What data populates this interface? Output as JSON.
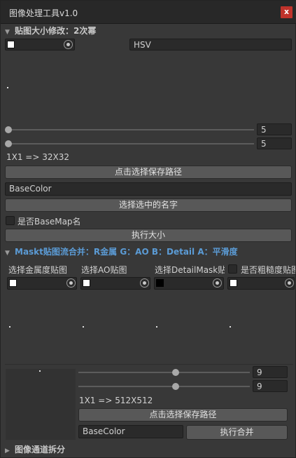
{
  "window": {
    "title": "图像处理工具v1.0",
    "close_label": "x"
  },
  "resize_section": {
    "header": "贴图大小修改：2次幂",
    "color_value": "#ffffff",
    "mode_field": "HSV",
    "slider1_value": "5",
    "slider2_value": "5",
    "size_info": "1X1 => 32X32",
    "choose_path_button": "点击选择保存路径",
    "name_field": "BaseColor",
    "select_name_button": "选择选中的名字",
    "basemap_checkbox_label": "是否BaseMap名",
    "execute_resize_button": "执行大小"
  },
  "mask_section": {
    "header_prefix": "Maskt贴图流合并：",
    "header_channels": "R金属 G：AO B：Detail A：平滑度",
    "channel_labels": [
      "选择金属度贴图",
      "选择AO贴图",
      "选择DetailMask贴",
      "是否粗糙度贴图?"
    ],
    "swatch_colors": [
      "#ffffff",
      "#ffffff",
      "#000000",
      "#ffffff"
    ],
    "slider1_value": "9",
    "slider2_value": "9",
    "size_info": "1X1 => 512X512",
    "choose_path_button": "点击选择保存路径",
    "name_field": "BaseColor",
    "execute_merge_button": "执行合并"
  },
  "split_section": {
    "header": "图像通道拆分"
  },
  "colors": {
    "accent_blue": "#5b9bd5",
    "close_red": "#c0332b"
  }
}
